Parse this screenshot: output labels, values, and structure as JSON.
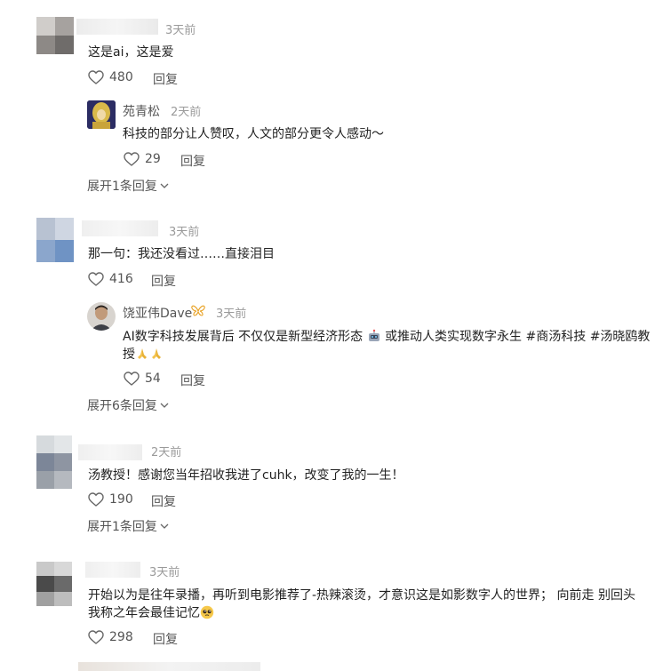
{
  "comments": [
    {
      "time": "3天前",
      "text": "这是ai，这是爱",
      "likes": "480",
      "reply_label": "回复",
      "sub_reply": {
        "name": "苑青松",
        "time": "2天前",
        "text": "科技的部分让人赞叹，人文的部分更令人感动～",
        "likes": "29",
        "reply_label": "回复"
      },
      "expand_label": "展开1条回复"
    },
    {
      "time": "3天前",
      "text": "那一句：我还没看过……直接泪目",
      "likes": "416",
      "reply_label": "回复",
      "sub_reply": {
        "name": "饶亚伟Dave",
        "time": "3天前",
        "text_line1": "AI数字科技发展背后 不仅仅是新型经济形态",
        "text_line1b": "或推动人类实现数字永生 #商汤科技 #汤晓鸥教",
        "text_line2": "授",
        "likes": "54",
        "reply_label": "回复"
      },
      "expand_label": "展开6条回复"
    },
    {
      "time": "2天前",
      "text": "汤教授！感谢您当年招收我进了cuhk，改变了我的一生！",
      "likes": "190",
      "reply_label": "回复",
      "expand_label": "展开1条回复"
    },
    {
      "time": "3天前",
      "text_line1": "开始以为是往年录播，再听到电影推荐了-热辣滚烫，才意识这是如影数字人的世界； 向前走 别回头",
      "text_line2": "我称之年会最佳记忆",
      "likes": "298",
      "reply_label": "回复"
    }
  ],
  "icons": {
    "like": "heart-outline-icon",
    "expand": "chevron-down-icon",
    "badge": "butterfly-icon",
    "robot": "robot-emoji",
    "pray": "praying-hands-emoji",
    "pleading": "pleading-face-emoji"
  },
  "colors": {
    "text": "#222222",
    "meta": "#9a9a9a",
    "action": "#555555",
    "badge": "#e8a020"
  }
}
